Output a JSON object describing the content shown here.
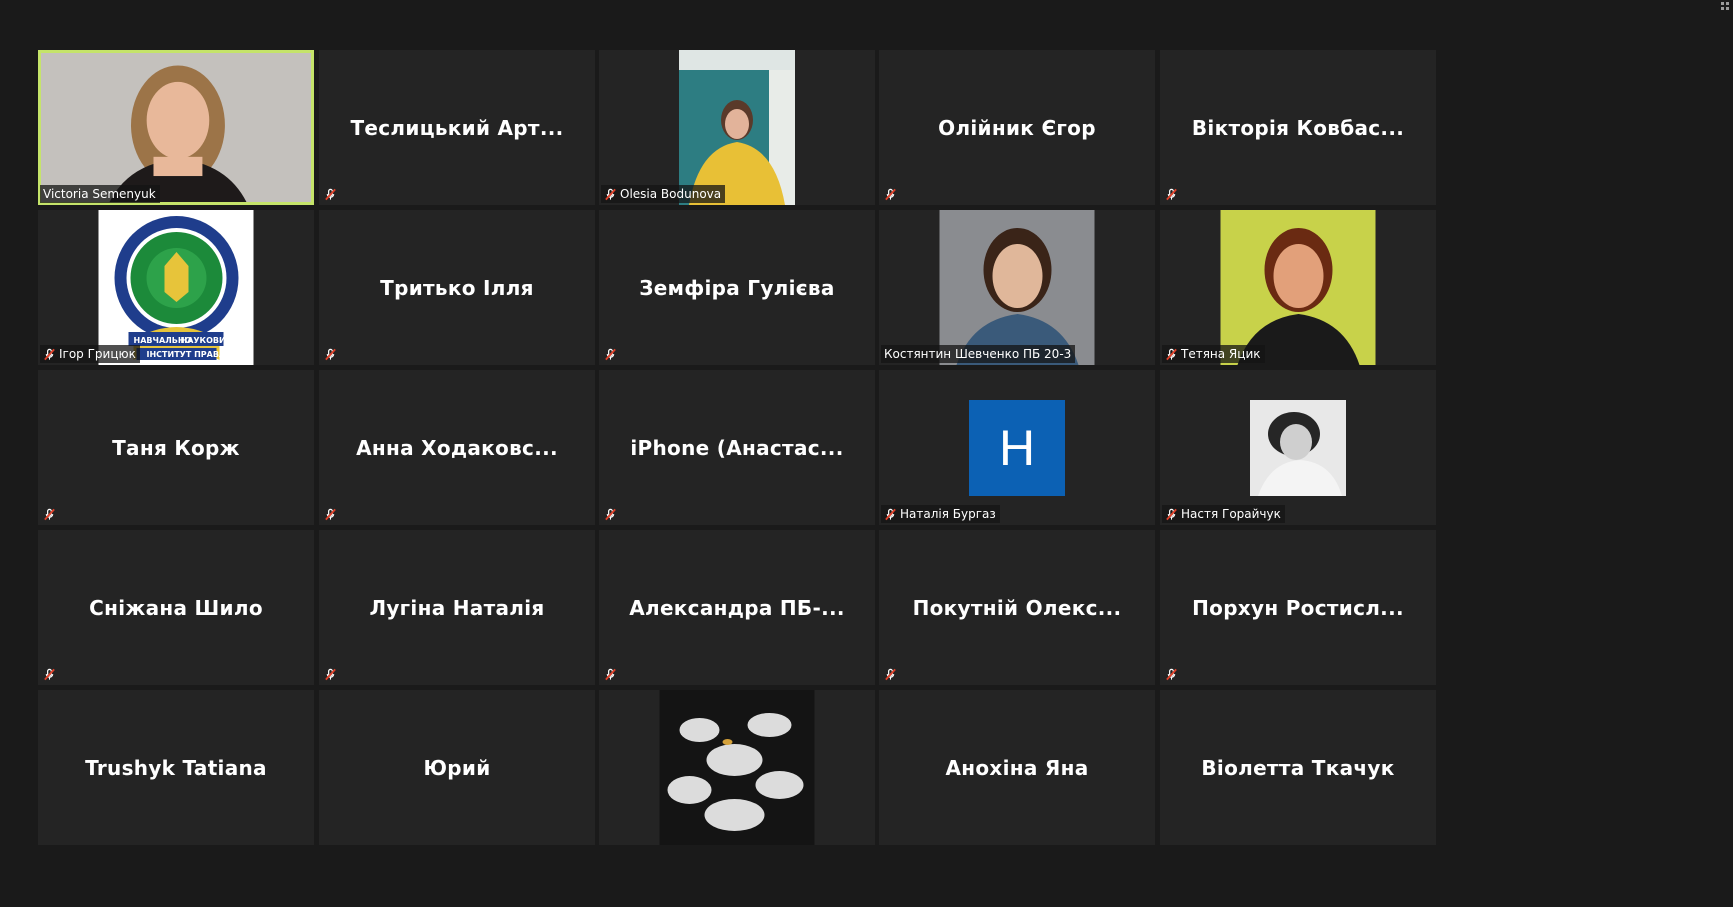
{
  "colors": {
    "background": "#1a1a1a",
    "tile": "#242424",
    "active_speaker_border": "#c5e46a",
    "muted_icon": "#e0412a",
    "avatar_blue": "#0c61b4"
  },
  "participants": [
    {
      "kind": "video",
      "name": "Victoria Semenyuk",
      "active": true,
      "muted": false
    },
    {
      "kind": "name",
      "name": "Теслицький  Арт...",
      "muted": true
    },
    {
      "kind": "video",
      "name": "Olesia Bodunova",
      "muted": true
    },
    {
      "kind": "name",
      "name": "Олійник Єгор",
      "muted": true
    },
    {
      "kind": "name",
      "name": "Вікторія  Ковбас...",
      "muted": true
    },
    {
      "kind": "emblem",
      "name": "Ігор Грицюк",
      "muted": true,
      "emblem_text": "НАВЧАЛЬНО НАУКОВИЙ ІНСТИТУТ ПРАВА"
    },
    {
      "kind": "name",
      "name": "Тритько Ілля",
      "muted": true
    },
    {
      "kind": "name",
      "name": "Земфіра Гулієва",
      "muted": true
    },
    {
      "kind": "photo",
      "name": "Костянтин Шевченко ПБ 20-3",
      "muted": false
    },
    {
      "kind": "photo",
      "name": "Тетяна Яцик",
      "muted": true
    },
    {
      "kind": "name",
      "name": "Таня Корж",
      "muted": true
    },
    {
      "kind": "name",
      "name": "Анна  Ходаковс...",
      "muted": true
    },
    {
      "kind": "name",
      "name": "iPhone  (Анастас...",
      "muted": true
    },
    {
      "kind": "avatar",
      "name": "Наталія Бургаз",
      "letter": "Н",
      "muted": true
    },
    {
      "kind": "avatar-photo",
      "name": "Настя Горайчук",
      "muted": true
    },
    {
      "kind": "name",
      "name": "Сніжана Шило",
      "muted": true
    },
    {
      "kind": "name",
      "name": "Лугіна Наталія",
      "muted": true
    },
    {
      "kind": "name",
      "name": "Александра  ПБ-...",
      "muted": true
    },
    {
      "kind": "name",
      "name": "Покутній  Олекс...",
      "muted": true
    },
    {
      "kind": "name",
      "name": "Порхун  Ростисл...",
      "muted": true
    },
    {
      "kind": "name",
      "name": "Trushyk Tatiana",
      "muted": false
    },
    {
      "kind": "name",
      "name": "Юрий",
      "muted": false
    },
    {
      "kind": "plant",
      "name": "",
      "muted": false
    },
    {
      "kind": "name",
      "name": "Анохіна Яна",
      "muted": false
    },
    {
      "kind": "name",
      "name": "Віолетта Ткачук",
      "muted": false
    }
  ]
}
